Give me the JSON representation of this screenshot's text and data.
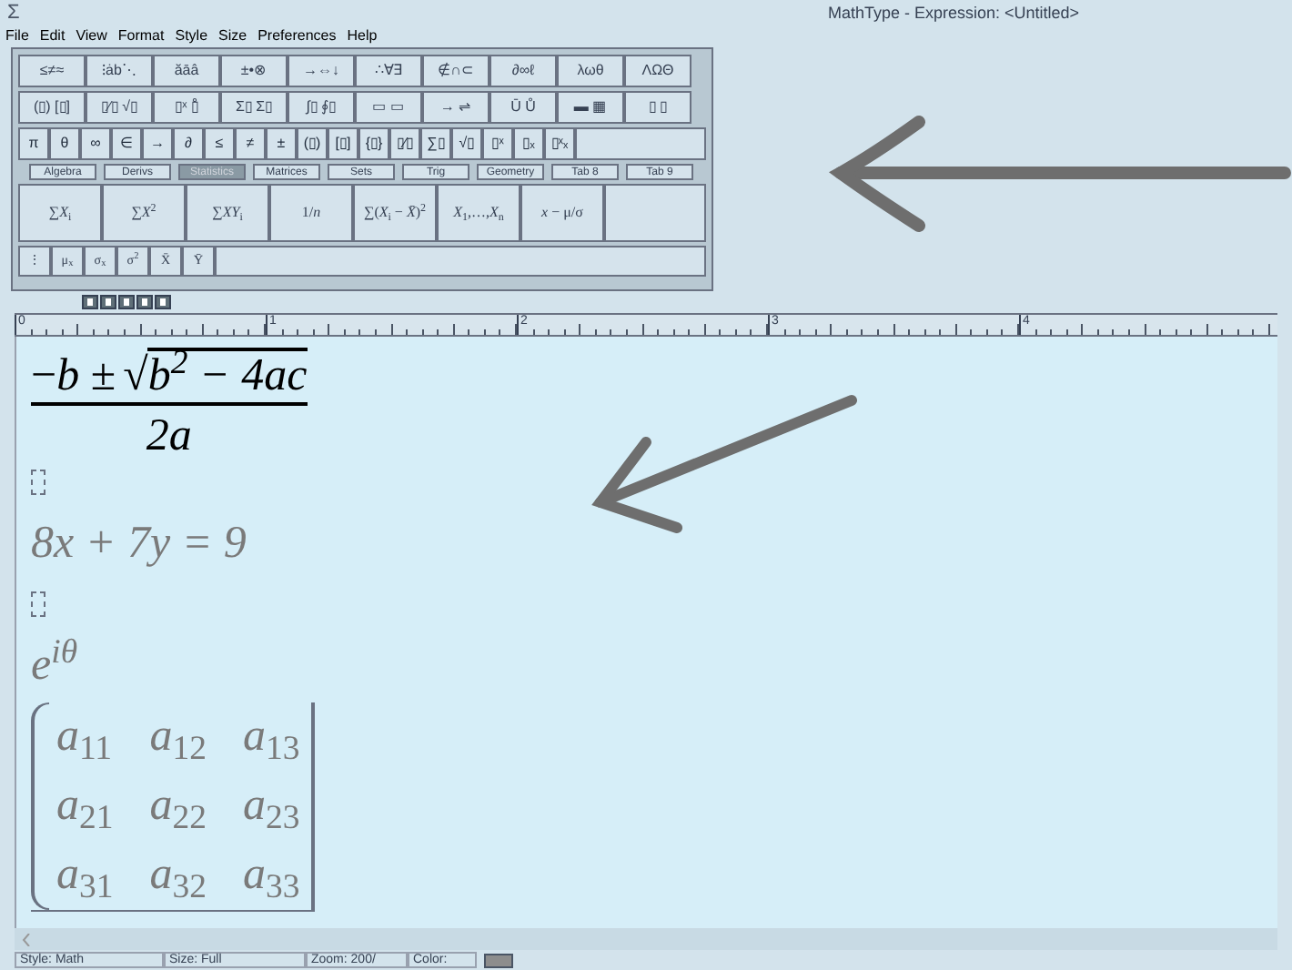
{
  "window": {
    "title": "MathType - Expression: <Untitled>",
    "app_glyph": "Σ"
  },
  "menu": [
    "File",
    "Edit",
    "View",
    "Format",
    "Style",
    "Size",
    "Preferences",
    "Help"
  ],
  "palette": {
    "symbol_rows": [
      [
        "≤≠≈",
        "⁝ȧb⋱",
        "ăāâ",
        "±•⊗",
        "→⇔↓",
        "∴∀∃",
        "∉∩⊂",
        "∂∞ℓ",
        "λωθ",
        "ΛΩΘ"
      ],
      [
        "(▯) [▯]",
        "▯⁄▯ √▯",
        "▯ˣ ▯̊",
        "Σ▯ Σ▯",
        "∫▯ ∮▯",
        "▭ ▭",
        "→ ⇌",
        "Ū Ů",
        "▬ ▦",
        "▯ ▯"
      ]
    ],
    "small_symbols": [
      "π",
      "θ",
      "∞",
      "∈",
      "→",
      "∂",
      "≤",
      "≠",
      "±",
      "(▯)",
      "[▯]",
      "{▯}",
      "▯⁄▯",
      "∑▯",
      "√▯",
      "▯ˣ",
      "▯ₓ",
      "▯ˣₓ"
    ],
    "tabs": [
      {
        "label": "Algebra",
        "selected": false
      },
      {
        "label": "Derivs",
        "selected": false
      },
      {
        "label": "Statistics",
        "selected": true
      },
      {
        "label": "Matrices",
        "selected": false
      },
      {
        "label": "Sets",
        "selected": false
      },
      {
        "label": "Trig",
        "selected": false
      },
      {
        "label": "Geometry",
        "selected": false
      },
      {
        "label": "Tab 8",
        "selected": false
      },
      {
        "label": "Tab 9",
        "selected": false
      }
    ],
    "templates": [
      "∑*X*$_{i}$",
      "∑*X*$^{2}$",
      "∑*XY*$_{i}$",
      "1/*n*",
      "∑(*X*$_{i}$ − *X̄*)$^{2}$",
      "*X*$_{1}$,…,*X*$_{n}$",
      "*x* − μ/σ"
    ],
    "template_extras": [
      "⋮",
      "μ$_{x}$",
      "σ$_{x}$",
      "σ$^{2}$",
      "X̄",
      "Ȳ"
    ]
  },
  "ruler": {
    "marks": [
      "0",
      "1",
      "2",
      "3",
      "4"
    ]
  },
  "equations": [
    {
      "kind": "quadratic",
      "lead": "−*b* ±",
      "radical": "√",
      "radicand": "b$^{2}$ − 4ac",
      "denominator": "2a"
    },
    {
      "kind": "placeholder"
    },
    {
      "kind": "line",
      "text": "8x + 7y = 9"
    },
    {
      "kind": "placeholder"
    },
    {
      "kind": "line",
      "text": "*e*$^{iθ}$"
    },
    {
      "kind": "matrix",
      "rows": [
        [
          "*a*$_{11}$",
          "*a*$_{12}$",
          "*a*$_{13}$"
        ],
        [
          "*a*$_{21}$",
          "*a*$_{22}$",
          "*a*$_{23}$"
        ],
        [
          "*a*$_{31}$",
          "*a*$_{32}$",
          "*a*$_{33}$"
        ]
      ]
    }
  ],
  "status": [
    "Style: Math",
    "Size: Full",
    "Zoom: 200/",
    "Color:"
  ]
}
